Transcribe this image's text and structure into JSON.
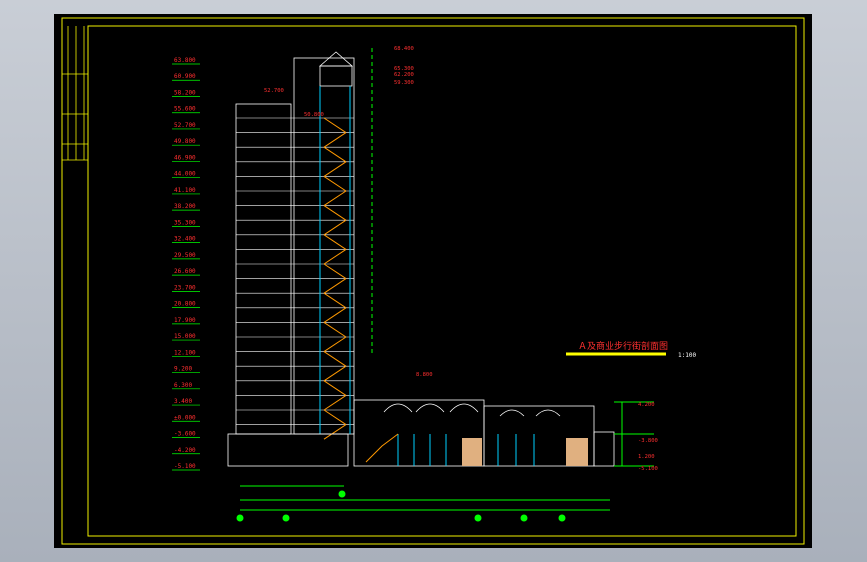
{
  "drawing": {
    "title_text": "Ａ及商业步行街剖面图",
    "title_scale": "1:100",
    "colors": {
      "background": "#000000",
      "frame": "#f0f000",
      "elevation_text": "#ff3030",
      "building_line": "#ffffff",
      "stair": "#ff9900",
      "glass": "#00d0ff",
      "dimension": "#00ff00",
      "wall_fill": "#e0b080",
      "title_bar": "#ffff00"
    },
    "left_elevations": [
      "63.800",
      "60.900",
      "58.200",
      "55.600",
      "52.700",
      "49.800",
      "46.900",
      "44.000",
      "41.100",
      "38.200",
      "35.300",
      "32.400",
      "29.500",
      "26.600",
      "23.700",
      "20.800",
      "17.900",
      "15.000",
      "12.100",
      "9.200",
      "6.300",
      "3.400",
      "±0.000",
      "-3.600",
      "-4.200",
      "-5.100"
    ],
    "top_labels": [
      "68.400",
      "65.300",
      "62.200",
      "59.300"
    ],
    "mid_labels": [
      "52.700",
      "50.800",
      "8.800"
    ],
    "right_labels": [
      "4.200",
      "-3.800",
      "1.200",
      "-5.100"
    ]
  }
}
